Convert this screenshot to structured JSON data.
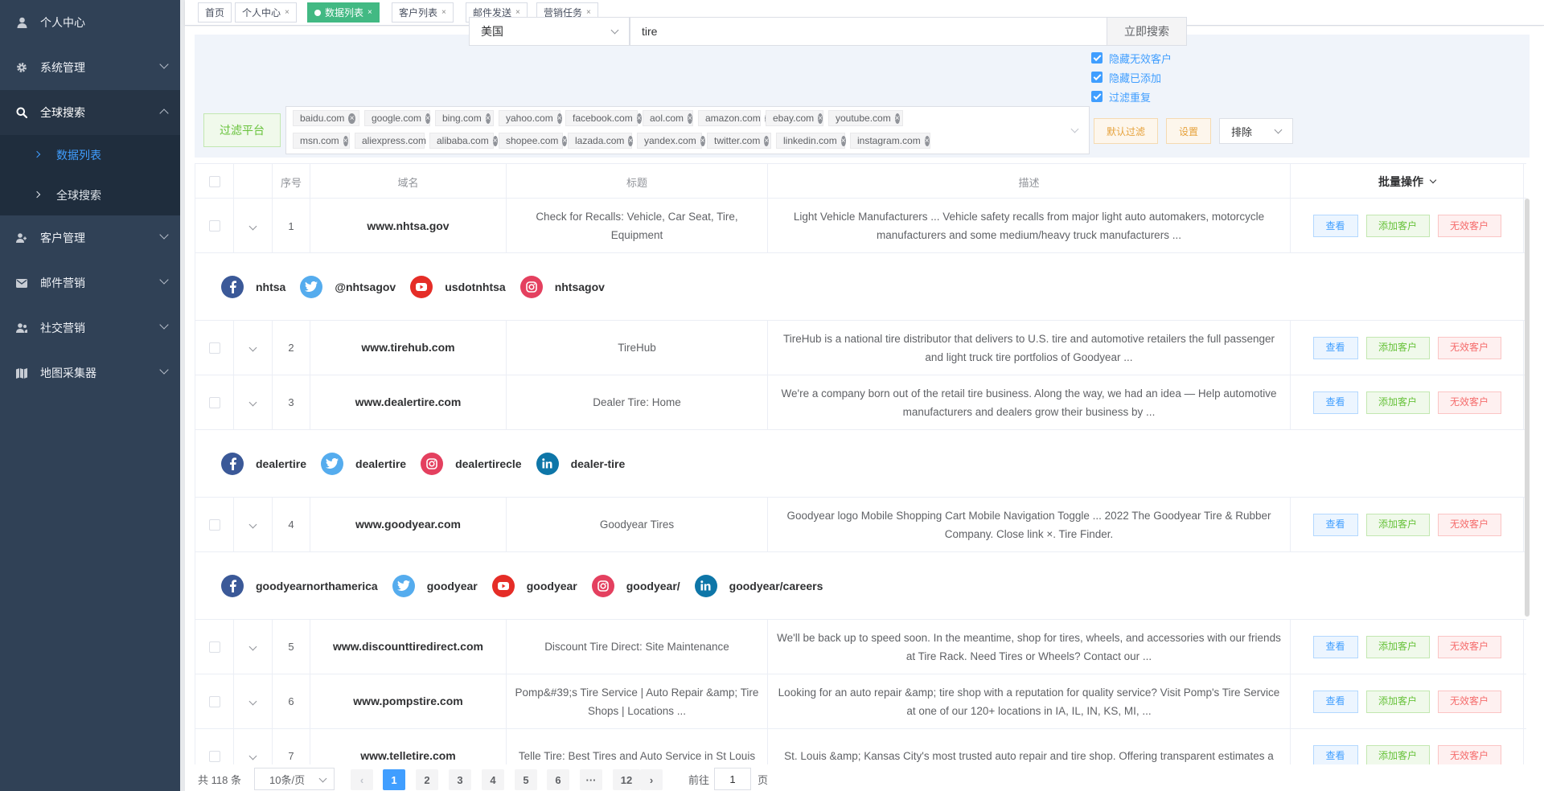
{
  "sidebar": {
    "items": [
      {
        "label": "个人中心",
        "icon": "user-icon"
      },
      {
        "label": "系统管理",
        "icon": "gear-icon"
      },
      {
        "label": "全球搜索",
        "icon": "search-icon"
      },
      {
        "label": "客户管理",
        "icon": "users-icon"
      },
      {
        "label": "邮件营销",
        "icon": "mail-icon"
      },
      {
        "label": "社交营销",
        "icon": "social-icon"
      },
      {
        "label": "地图采集器",
        "icon": "map-icon"
      }
    ],
    "sub_items": [
      "数据列表",
      "全球搜索"
    ]
  },
  "tabs": [
    {
      "label": "首页"
    },
    {
      "label": "个人中心",
      "close": "×"
    },
    {
      "label": "数据列表",
      "close": "×"
    },
    {
      "label": "客户列表",
      "close": "×"
    },
    {
      "label": "邮件发送",
      "close": "×"
    },
    {
      "label": "营销任务",
      "close": "×"
    }
  ],
  "search": {
    "country": "美国",
    "keyword": "tire",
    "search_button": "立即搜索",
    "checkboxes": [
      "隐藏无效客户",
      "隐藏已添加",
      "过滤重复"
    ],
    "filter_button": "过滤平台",
    "platforms_row1": [
      "baidu.com",
      "google.com",
      "bing.com",
      "yahoo.com",
      "facebook.com",
      "aol.com",
      "amazon.com",
      "ebay.com",
      "youtube.com"
    ],
    "platforms_row2": [
      "msn.com",
      "aliexpress.com",
      "alibaba.com",
      "shopee.com",
      "lazada.com",
      "yandex.com",
      "twitter.com",
      "linkedin.com",
      "instagram.com"
    ],
    "tag_close": "×",
    "default_filter_button": "默认过滤",
    "settings_button": "设置",
    "exclude_select": "排除"
  },
  "table": {
    "headers": {
      "index": "序号",
      "domain": "域名",
      "title": "标题",
      "desc": "描述",
      "bulk": "批量操作"
    },
    "action_labels": {
      "view": "查看",
      "add": "添加客户",
      "invalid": "无效客户"
    },
    "rows": [
      {
        "index": "1",
        "domain": "www.nhtsa.gov",
        "title": "Check for Recalls: Vehicle, Car Seat, Tire, Equipment",
        "desc": "Light Vehicle Manufacturers ... Vehicle safety recalls from major light auto automakers, motorcycle manufacturers and some medium/heavy truck manufacturers ..."
      },
      {
        "index": "2",
        "domain": "www.tirehub.com",
        "title": "TireHub",
        "desc": "TireHub is a national tire distributor that delivers to U.S. tire and automotive retailers the full passenger and light truck tire portfolios of Goodyear ..."
      },
      {
        "index": "3",
        "domain": "www.dealertire.com",
        "title": "Dealer Tire: Home",
        "desc": "We're a company born out of the retail tire business. Along the way, we had an idea — Help automotive manufacturers and dealers grow their business by ..."
      },
      {
        "index": "4",
        "domain": "www.goodyear.com",
        "title": "Goodyear Tires",
        "desc": "Goodyear logo Mobile Shopping Cart Mobile Navigation Toggle ... 2022 The Goodyear Tire & Rubber Company. Close link ×. Tire Finder."
      },
      {
        "index": "5",
        "domain": "www.discounttiredirect.com",
        "title": "Discount Tire Direct: Site Maintenance",
        "desc": "We'll be back up to speed soon. In the meantime, shop for tires, wheels, and accessories with our friends at Tire Rack. Need Tires or Wheels? Contact our ..."
      },
      {
        "index": "6",
        "domain": "www.pompstire.com",
        "title": "Pomp&#39;s Tire Service | Auto Repair &amp; Tire Shops | Locations ...",
        "desc": "Looking for an auto repair &amp; tire shop with a reputation for quality service? Visit Pomp's Tire Service at one of our 120+ locations in IA, IL, IN, KS, MI, ..."
      },
      {
        "index": "7",
        "domain": "www.telletire.com",
        "title": "Telle Tire: Best Tires and Auto Service in St Louis",
        "desc": "St. Louis &amp; Kansas City's most trusted auto repair and tire shop. Offering transparent estimates a"
      }
    ],
    "socials": [
      [
        {
          "type": "facebook",
          "name": "nhtsa"
        },
        {
          "type": "twitter",
          "name": "@nhtsagov"
        },
        {
          "type": "youtube",
          "name": "usdotnhtsa"
        },
        {
          "type": "instagram",
          "name": "nhtsagov"
        }
      ],
      [
        {
          "type": "facebook",
          "name": "dealertire"
        },
        {
          "type": "twitter",
          "name": "dealertire"
        },
        {
          "type": "instagram",
          "name": "dealertirecle"
        },
        {
          "type": "linkedin",
          "name": "dealer-tire"
        }
      ],
      [
        {
          "type": "facebook",
          "name": "goodyearnorthamerica"
        },
        {
          "type": "twitter",
          "name": "goodyear"
        },
        {
          "type": "youtube",
          "name": "goodyear"
        },
        {
          "type": "instagram",
          "name": "goodyear/"
        },
        {
          "type": "linkedin",
          "name": "goodyear/careers"
        }
      ]
    ]
  },
  "pagination": {
    "total": "共 118 条",
    "page_size": "10条/页",
    "pages": [
      "1",
      "2",
      "3",
      "4",
      "5",
      "6",
      "···",
      "12"
    ],
    "current": "1",
    "goto_label": "前往",
    "goto_value": "1",
    "page_suffix": "页"
  },
  "colors": {
    "sidebar_bg": "#304156",
    "accent": "#409eff",
    "active_tab": "#42b983",
    "success": "#67c23a",
    "danger": "#f56c6c",
    "warning": "#e6a23c",
    "facebook": "#3b5998",
    "twitter": "#55acee",
    "youtube": "#e52d27",
    "instagram": "#e4405f",
    "linkedin": "#0e76a8"
  }
}
